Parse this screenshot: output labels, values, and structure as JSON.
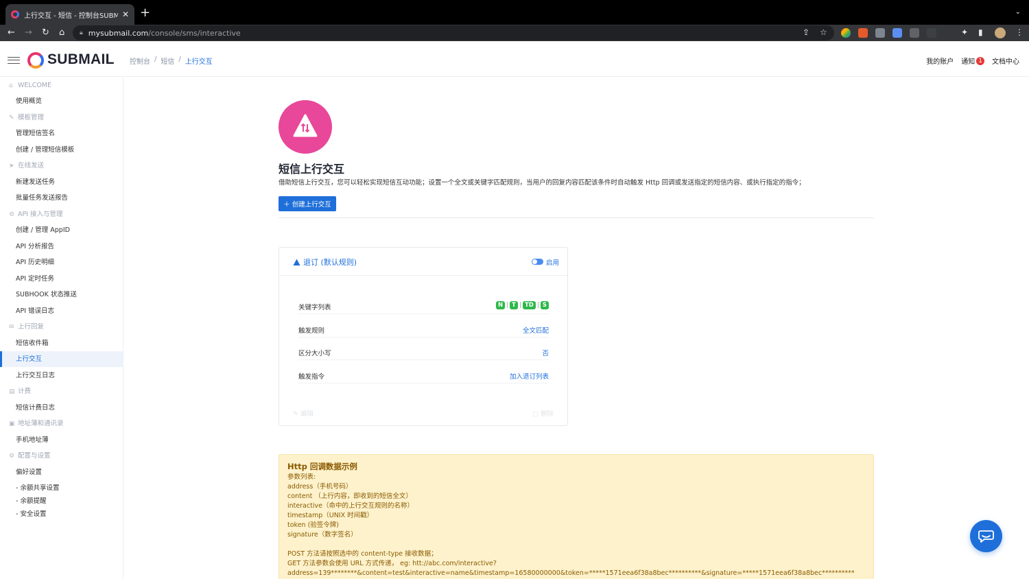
{
  "browser": {
    "tab_title": "上行交互 - 短信 - 控制台SUBMAIL",
    "tab_close": "✕",
    "new_tab": "+",
    "tab_menu": "⌄",
    "url_host": "mysubmail.com",
    "url_path": "/console/sms/interactive"
  },
  "header": {
    "logo": "SUBMAIL",
    "breadcrumb": [
      "控制台",
      "/",
      "短信",
      "/",
      "上行交互"
    ],
    "account": "我的账户",
    "notice": "通知",
    "notice_count": "1",
    "docs": "文档中心"
  },
  "sidebar": {
    "groups": [
      {
        "label": "WELCOME",
        "items": [
          "使用概览"
        ]
      },
      {
        "label": "模板管理",
        "items": [
          "管理短信签名",
          "创建 / 管理短信模板"
        ]
      },
      {
        "label": "在线发送",
        "items": [
          "新建发送任务",
          "批量任务发送报告"
        ]
      },
      {
        "label": "API 接入与管理",
        "items": [
          "创建 / 管理 AppID",
          "API 分析报告",
          "API 历史明细",
          "API 定时任务",
          "SUBHOOK 状态推送",
          "API 错误日志"
        ]
      },
      {
        "label": "上行回复",
        "items": [
          "短信收件箱",
          "上行交互",
          "上行交互日志"
        ]
      },
      {
        "label": "计费",
        "items": [
          "短信计费日志"
        ]
      },
      {
        "label": "地址薄和通讯录",
        "items": [
          "手机地址薄"
        ]
      },
      {
        "label": "配置与设置",
        "items": [
          "偏好设置"
        ]
      }
    ],
    "sub_items": [
      "- 余额共享设置",
      "- 余额提醒",
      "- 安全设置"
    ],
    "active_item": "上行交互"
  },
  "main": {
    "title": "短信上行交互",
    "description": "借助短信上行交互，您可以轻松实现短信互动功能；设置一个全文或关键字匹配规则，当用户的回复内容匹配该条件时自动触发 Http 回调或发送指定的短信内容、或执行指定的指令；",
    "create_button": "创建上行交互",
    "rule_card": {
      "title": "退订 (默认规则)",
      "toggle_label": "启用",
      "toggle_on": true,
      "keywords_label": "关键字列表",
      "keywords": [
        "N",
        "T",
        "TD",
        "S"
      ],
      "trigger_rule_label": "触发规则",
      "trigger_rule_value": "全文匹配",
      "case_label": "区分大小写",
      "case_value": "否",
      "command_label": "触发指令",
      "command_value": "加入退订列表",
      "edit_label": "编辑",
      "delete_label": "删除"
    },
    "callback": {
      "title": "Http 回调数据示例",
      "lines": [
        "参数列表:",
        "address（手机号码）",
        "content （上行内容，即收到的短信全文）",
        "interactive（命中的上行交互规则的名称）",
        "timestamp（UNIX 时间戳）",
        "token (验签令牌)",
        "signature（数字签名）"
      ],
      "lines2": [
        "POST 方法请按照选中的 content-type 接收数据；",
        "GET 方法参数会使用 URL 方式传递， eg: htt://abc.com/interactive?",
        "address=139********&content=test&interactive=name&timestamp=16580000000&token=*****1571eea6f38a8bec**********&signature=*****1571eea6f38a8bec**********"
      ]
    }
  },
  "colors": {
    "accent": "#1e6fd9",
    "hero": "#e8479a",
    "keyword_badge": "#2eb84b",
    "callback_bg": "#fdf2cc"
  }
}
